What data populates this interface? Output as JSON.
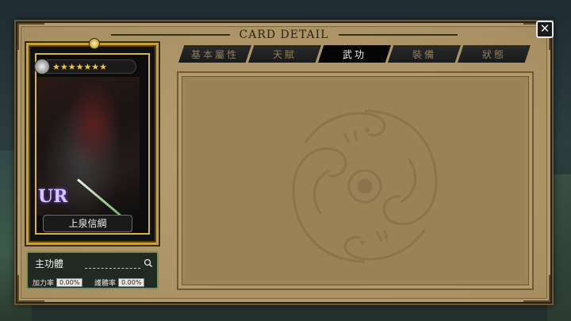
{
  "window": {
    "title": "CARD DETAIL"
  },
  "close_button": {
    "label": "✕"
  },
  "card": {
    "stars": "★★★★★★★",
    "rarity": "UR",
    "name": "上泉信綱"
  },
  "skill_panel": {
    "label": "主功體",
    "search_placeholder": "",
    "stats": [
      {
        "label": "加力率",
        "value": "0.00%"
      },
      {
        "label": "護體率",
        "value": "0.00%"
      }
    ]
  },
  "tabs": [
    {
      "label": "基本屬性",
      "active": false
    },
    {
      "label": "天賦",
      "active": false
    },
    {
      "label": "武功",
      "active": true
    },
    {
      "label": "裝備",
      "active": false
    },
    {
      "label": "狀態",
      "active": false
    }
  ],
  "colors": {
    "parchment": "#b19a6e",
    "gold_border": "#c7a13a",
    "active_tab": "#050505",
    "stars": "#f2c53a"
  }
}
